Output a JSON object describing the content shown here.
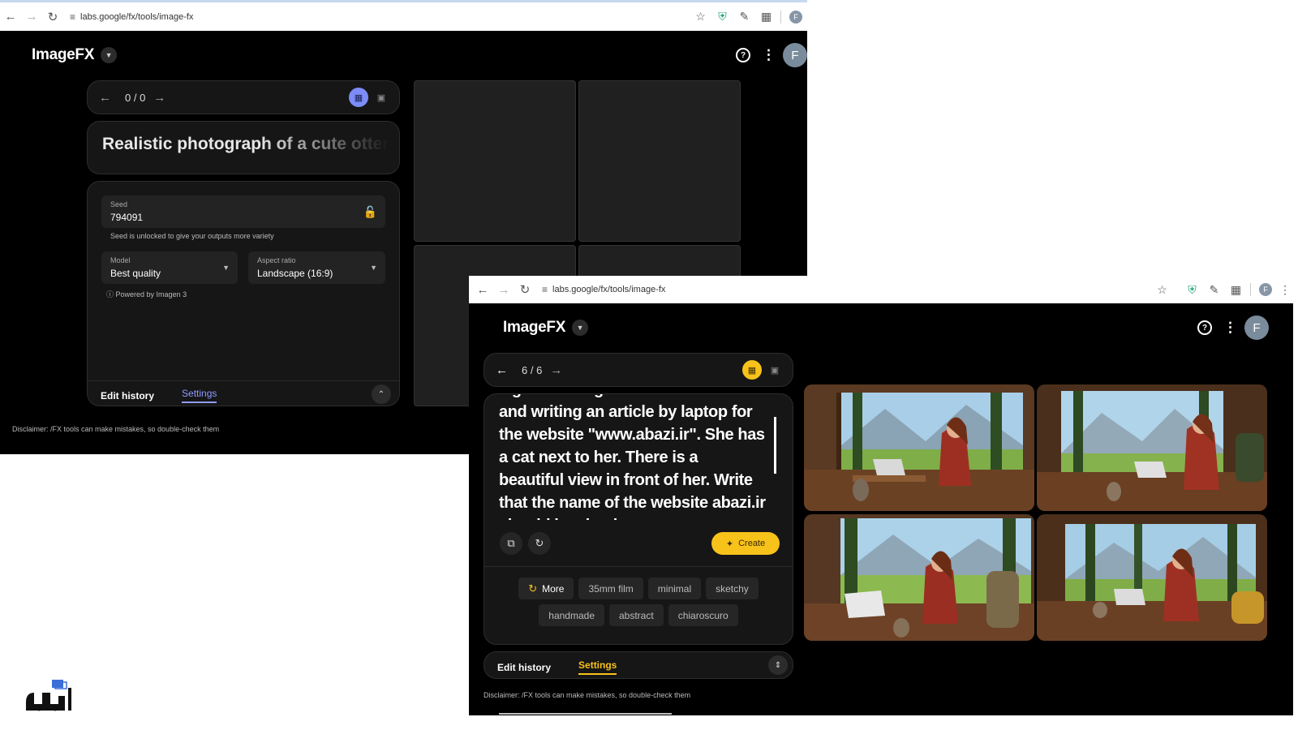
{
  "browser": {
    "url": "labs.google/fx/tools/image-fx",
    "profile_initial": "F"
  },
  "app": {
    "title": "ImageFX",
    "avatar_initial": "F"
  },
  "window1": {
    "counter": "0 / 0",
    "prompt": "Realistic photograph of a cute otter zo",
    "settings": {
      "seed_label": "Seed",
      "seed_value": "794091",
      "seed_hint": "Seed is unlocked to give your outputs more variety",
      "model_label": "Model",
      "model_value": "Best quality",
      "aspect_label": "Aspect ratio",
      "aspect_value": "Landscape (16:9)",
      "powered_by": "Powered by Imagen 3"
    },
    "tabs": {
      "edit_history": "Edit history",
      "settings": "Settings"
    },
    "disclaimer": "Disclaimer: /FX tools can make mistakes, so double-check them"
  },
  "window2": {
    "counter": "6 / 6",
    "prompt": "a girl is sitting at a wooden table and writing an article by laptop for the website \"www.abazi.ir\". She has a cat next to her. There is a beautiful view in front of her. Write that the name of the website abazi.ir should be clearly",
    "create_label": "Create",
    "chips": {
      "more": "More",
      "items": [
        "35mm film",
        "minimal",
        "sketchy",
        "handmade",
        "abstract",
        "chiaroscuro"
      ]
    },
    "tabs": {
      "edit_history": "Edit history",
      "settings": "Settings"
    },
    "disclaimer": "Disclaimer: /FX tools can make mistakes, so double-check them"
  },
  "colors": {
    "accent_blue": "#8f9cff",
    "accent_yellow": "#f7c21a",
    "background": "#000000",
    "panel": "#161616"
  },
  "icons": [
    "back-icon",
    "forward-icon",
    "reload-icon",
    "site-settings-icon",
    "star-icon",
    "shield-icon",
    "pen-icon",
    "puzzle-icon",
    "help-icon",
    "kebab-icon",
    "grid-view-icon",
    "single-view-icon",
    "unlock-icon",
    "caret-down-icon",
    "chevron-updown-icon",
    "copy-icon",
    "refresh-icon",
    "sparkle-icon"
  ]
}
